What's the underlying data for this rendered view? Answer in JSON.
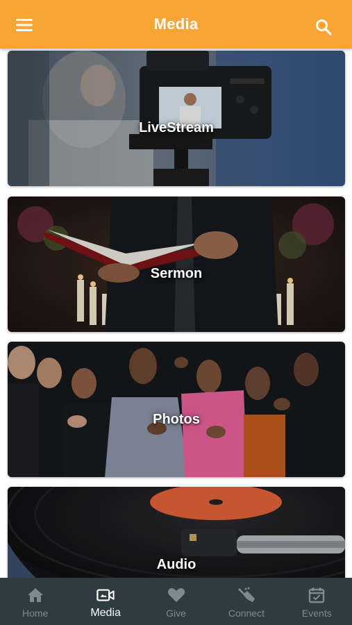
{
  "header": {
    "title": "Media",
    "menu_icon": "hamburger-menu-icon",
    "search_icon": "search-icon",
    "background": "#F8A535"
  },
  "cards": [
    {
      "label": "LiveStream",
      "image": "camera-livestream-photo"
    },
    {
      "label": "Sermon",
      "image": "preacher-bible-photo"
    },
    {
      "label": "Photos",
      "image": "worship-crowd-photo"
    },
    {
      "label": "Audio",
      "image": "vinyl-turntable-photo"
    }
  ],
  "bottom_nav": {
    "background": "#2E3C41",
    "active_color": "#FFFFFF",
    "inactive_color": "#7E8A90",
    "items": [
      {
        "label": "Home",
        "icon": "home-icon",
        "active": false
      },
      {
        "label": "Media",
        "icon": "video-camera-icon",
        "active": true
      },
      {
        "label": "Give",
        "icon": "heart-icon",
        "active": false
      },
      {
        "label": "Connect",
        "icon": "connect-hands-icon",
        "active": false
      },
      {
        "label": "Events",
        "icon": "calendar-check-icon",
        "active": false
      }
    ]
  }
}
